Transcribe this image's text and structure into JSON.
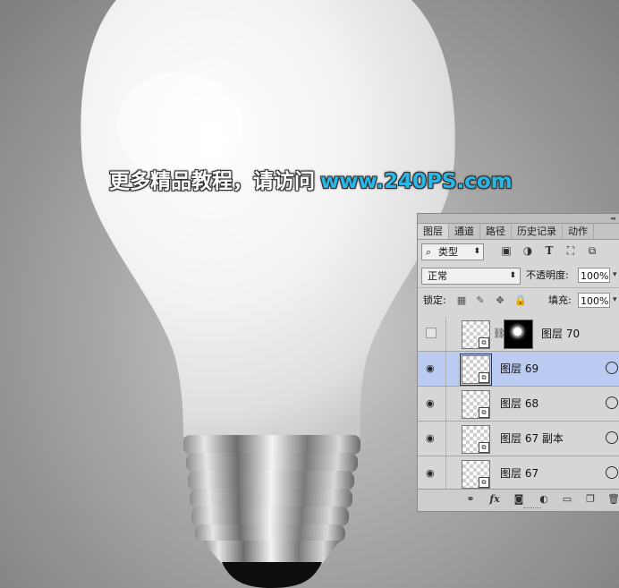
{
  "watermark": {
    "chinese": "更多精品教程，请访问",
    "url": "www.240PS.com"
  },
  "layers_panel": {
    "tabs": [
      {
        "label": "图层",
        "active": true
      },
      {
        "label": "通道"
      },
      {
        "label": "路径"
      },
      {
        "label": "历史记录"
      },
      {
        "label": "动作"
      }
    ],
    "filter": {
      "value": "类型",
      "search_icon": "search-icon"
    },
    "blend_mode": "正常",
    "opacity_label": "不透明度:",
    "opacity_value": "100%",
    "lock_label": "锁定:",
    "fill_label": "填充:",
    "fill_value": "100%",
    "layers": [
      {
        "name": "图层 70",
        "visible": false,
        "has_mask": true,
        "selected": false
      },
      {
        "name": "图层 69",
        "visible": true,
        "has_mask": false,
        "selected": true
      },
      {
        "name": "图层 68",
        "visible": true,
        "has_mask": false,
        "selected": false
      },
      {
        "name": "图层 67 副本",
        "visible": true,
        "has_mask": false,
        "selected": false
      },
      {
        "name": "图层 67",
        "visible": true,
        "has_mask": false,
        "selected": false
      }
    ],
    "bottom_icons": [
      "link-icon",
      "fx-icon",
      "add-mask-icon",
      "adjustment-icon",
      "folder-icon",
      "new-layer-icon",
      "trash-icon"
    ],
    "colors": {
      "selected_row": "#bccbf2",
      "panel_bg": "#d6d6d6"
    }
  }
}
